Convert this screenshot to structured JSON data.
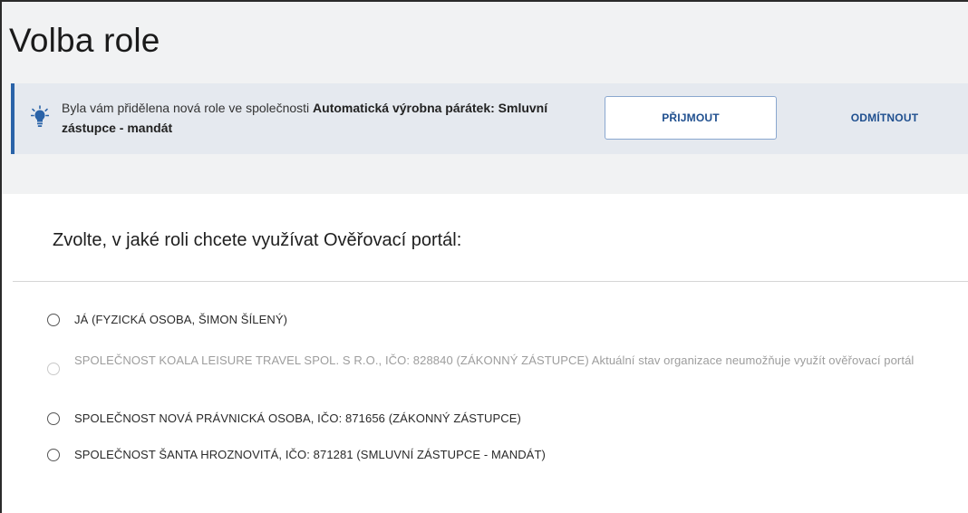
{
  "page": {
    "title": "Volba role"
  },
  "banner": {
    "icon": "lightbulb-icon",
    "message_prefix": "Byla vám přidělena nová role ve společnosti ",
    "company_role": "Automatická výrobna párátek: Smluvní zástupce - mandát",
    "accept_label": "PŘIJMOUT",
    "reject_label": "ODMÍTNOUT",
    "accent_color": "#2a63a8"
  },
  "role_selection": {
    "heading": "Zvolte, v jaké roli chcete využívat Ověřovací portál:",
    "options": [
      {
        "label": "JÁ (FYZICKÁ OSOBA, ŠIMON ŠÍLENÝ)",
        "note": "",
        "disabled": false
      },
      {
        "label": "SPOLEČNOST KOALA LEISURE TRAVEL SPOL. S R.O., IČO: 828840 (ZÁKONNÝ ZÁSTUPCE)",
        "note": " Aktuální stav organizace neumožňuje využít ověřovací portál",
        "disabled": true
      },
      {
        "label": "SPOLEČNOST NOVÁ PRÁVNICKÁ OSOBA, IČO: 871656 (ZÁKONNÝ ZÁSTUPCE)",
        "note": "",
        "disabled": false
      },
      {
        "label": "SPOLEČNOST ŠANTA HROZNOVITÁ, IČO: 871281 (SMLUVNÍ ZÁSTUPCE - MANDÁT)",
        "note": "",
        "disabled": false
      }
    ]
  }
}
